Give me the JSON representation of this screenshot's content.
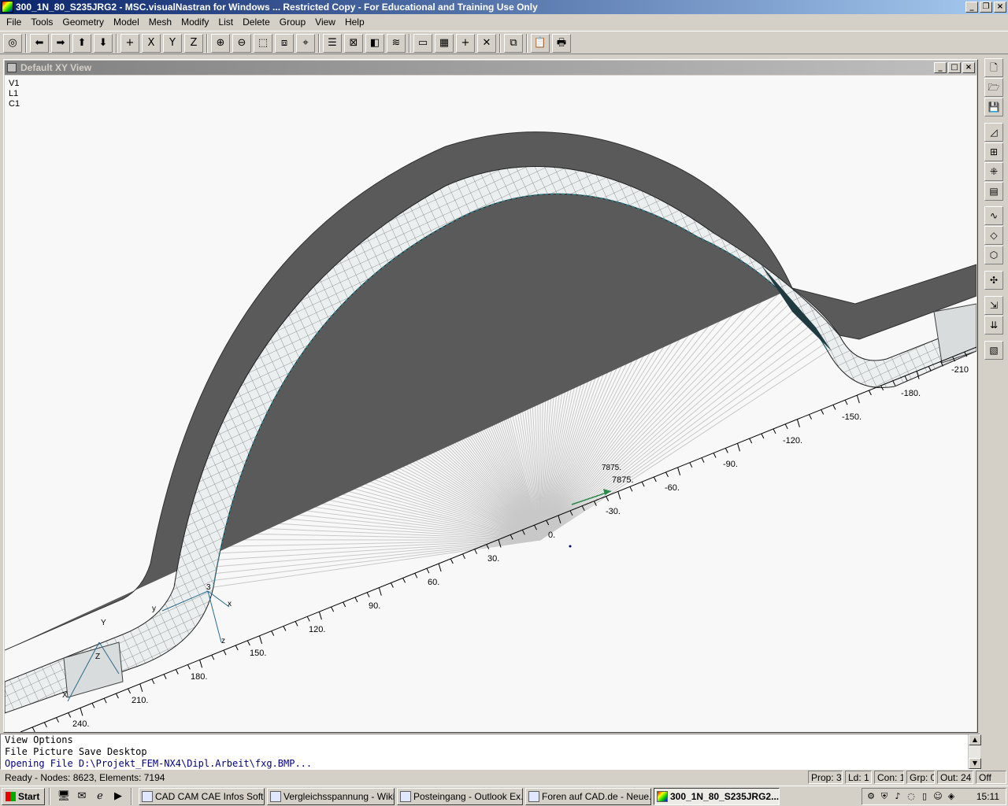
{
  "window": {
    "title": "300_1N_80_S235JRG2 - MSC.visualNastran for Windows ... Restricted Copy - For Educational and Training Use Only"
  },
  "menu": [
    "File",
    "Tools",
    "Geometry",
    "Model",
    "Mesh",
    "Modify",
    "List",
    "Delete",
    "Group",
    "View",
    "Help"
  ],
  "toolbar": {
    "icons": [
      "dynamic-rotate-icon",
      "rotate-left-icon",
      "rotate-right-icon",
      "rotate-up-icon",
      "rotate-down-icon",
      "center-icon",
      "rotate-x-icon",
      "rotate-y-icon",
      "rotate-z-icon",
      "zoom-in-icon",
      "zoom-out-icon",
      "zoom-window-icon",
      "autoscale-icon",
      "pan-icon",
      "list-icon",
      "wireframe-icon",
      "solid-icon",
      "layers-icon",
      "view-window-icon",
      "grid-icon",
      "add-icon",
      "delete-icon",
      "clip-icon",
      "paste-icon",
      "print-icon"
    ],
    "rotate_labels": {
      "x": "X",
      "y": "Y",
      "z": "Z"
    }
  },
  "viewport": {
    "title": "Default XY View",
    "labels": [
      "V1",
      "L1",
      "C1"
    ],
    "axis_ticks_front": [
      "240.",
      "210.",
      "180.",
      "150.",
      "120.",
      "90.",
      "60.",
      "30.",
      "0."
    ],
    "axis_ticks_back": [
      "-30.",
      "-60.",
      "-90.",
      "-120.",
      "-150.",
      "-180.",
      "-210"
    ],
    "coord_labels": [
      "3",
      "x",
      "y",
      "z",
      "Y",
      "Z",
      "X"
    ],
    "values": [
      "7875.",
      "7875."
    ],
    "colors": {
      "background": "#f8f8f8",
      "shell_dark": "#5a5a5a",
      "shell_light": "#ecefef",
      "mesh": "#202020",
      "fan": "#c8c8c8",
      "axis": "#000000"
    }
  },
  "messages": [
    "View Options",
    "File Picture Save Desktop",
    "Opening File D:\\Projekt_FEM-NX4\\Dipl.Arbeit\\fxg.BMP..."
  ],
  "status": {
    "ready": "Ready - Nodes: 8623,  Elements: 7194",
    "prop": "Prop: 3",
    "ld": "Ld: 1",
    "con": "Con: 1",
    "grp": "Grp: 0",
    "out": "Out: 24",
    "off": "Off"
  },
  "taskbar": {
    "start": "Start",
    "tasks": [
      "CAD CAM CAE Infos Soft...",
      "Vergleichsspannung - Wiki...",
      "Posteingang - Outlook Ex...",
      "Foren auf CAD.de - Neue...",
      "300_1N_80_S235JRG2..."
    ],
    "clock": "15:11"
  }
}
